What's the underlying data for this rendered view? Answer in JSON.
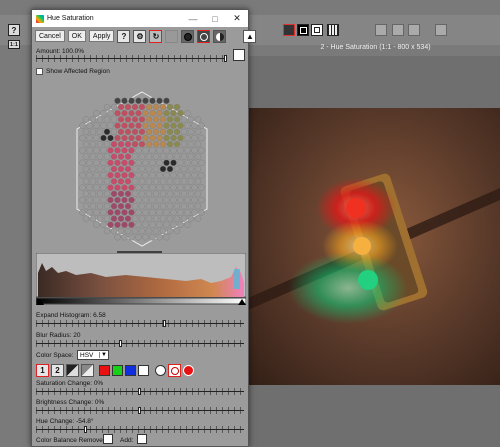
{
  "dialog": {
    "title": "Hue Saturation",
    "toolbar": {
      "cancel": "Cancel",
      "ok": "OK",
      "apply": "Apply",
      "help": "?"
    },
    "amount_label": "Amount: 100.0%",
    "amount_value": 1.0,
    "show_affected_label": "Show Affected Region",
    "expand_hist_label": "Expand Histogram: 6.58",
    "expand_hist_pos": 0.62,
    "blur_label": "Blur Radius: 20",
    "blur_pos": 0.41,
    "colorspace_label": "Color Space:",
    "colorspace_value": "HSV",
    "mode_1": "1",
    "mode_2": "2",
    "saturation_label": "Saturation Change: 0%",
    "saturation_pos": 0.5,
    "brightness_label": "Brightness Change: 0%",
    "brightness_pos": 0.5,
    "hue_label": "Hue Change: -54.8°",
    "hue_pos": 0.24,
    "balance_label": "Color Balance Remove:",
    "add_label": "Add:",
    "swatch_colors": [
      "#e81010",
      "#18d018",
      "#1030e0",
      "#ffffff"
    ]
  },
  "app": {
    "doc_title": "2 - Hue Saturation (1:1 - 800 x 534)",
    "left_tools": [
      "?",
      "1:1"
    ]
  }
}
